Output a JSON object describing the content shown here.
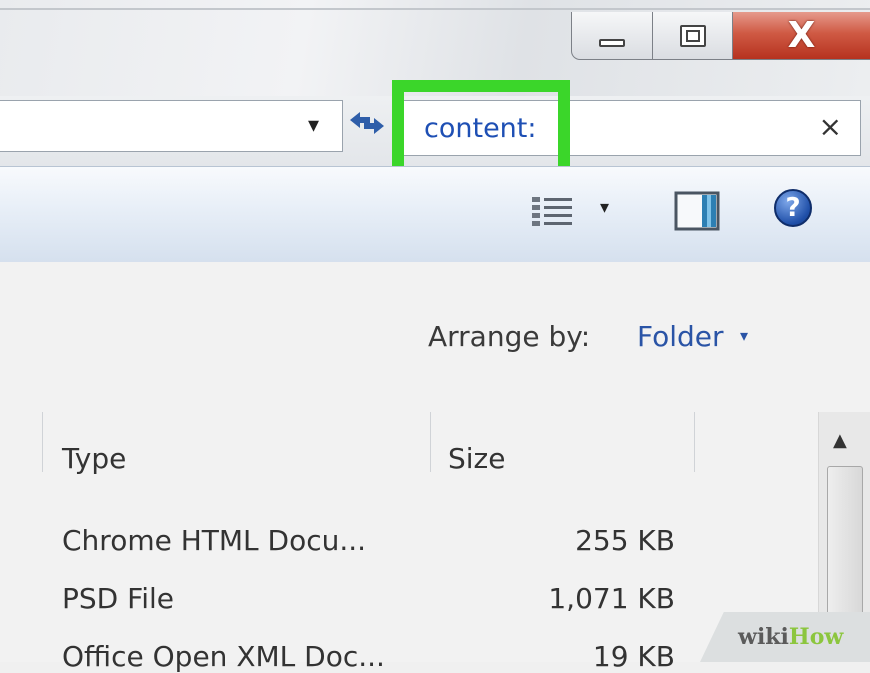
{
  "window": {
    "minimize_icon": "minimize-icon",
    "maximize_icon": "maximize-icon",
    "close_icon": "close-icon",
    "close_glyph": "X",
    "close_color": "#c43a26"
  },
  "address": {
    "dropdown_glyph": "▾",
    "refresh_icon": "refresh-arrows-icon"
  },
  "search": {
    "value": "content:",
    "clear_glyph": "×",
    "highlight_color": "#3bd62a"
  },
  "toolbar": {
    "views_icon": "details-view-icon",
    "views_arrow": "▾",
    "preview_icon": "preview-pane-icon",
    "help_glyph": "?"
  },
  "arrange": {
    "label": "Arrange by:",
    "value": "Folder",
    "arrow": "▾"
  },
  "table": {
    "columns": [
      "Type",
      "Size"
    ],
    "rows": [
      {
        "type": "Chrome HTML Docu...",
        "size": "255 KB"
      },
      {
        "type": "PSD File",
        "size": "1,071 KB"
      },
      {
        "type": "Office Open XML Doc...",
        "size": "19 KB"
      }
    ]
  },
  "scrollbar": {
    "up_glyph": "▲"
  },
  "watermark": {
    "part1": "wiki",
    "part2": "How"
  }
}
